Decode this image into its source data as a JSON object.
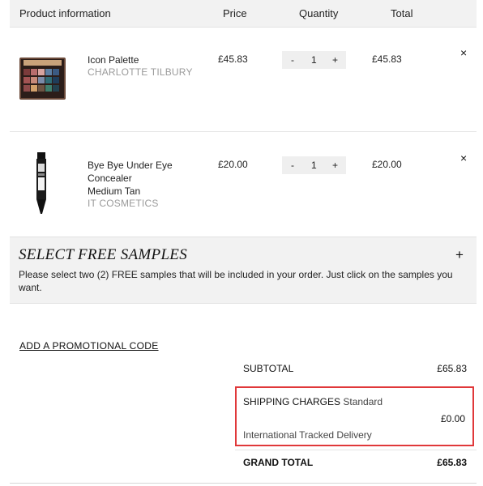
{
  "table_header": {
    "product_info": "Product information",
    "price": "Price",
    "quantity": "Quantity",
    "total": "Total"
  },
  "items": [
    {
      "name": "Icon Palette",
      "variant": "",
      "brand": "CHARLOTTE TILBURY",
      "price": "£45.83",
      "qty_minus": "-",
      "quantity": "1",
      "qty_plus": "+",
      "total": "£45.83",
      "remove": "×",
      "image_icon": "eyeshadow-palette"
    },
    {
      "name_line1": "Bye Bye Under Eye",
      "name_line2": "Concealer",
      "variant": "Medium Tan",
      "brand": "IT COSMETICS",
      "price": "£20.00",
      "qty_minus": "-",
      "quantity": "1",
      "qty_plus": "+",
      "total": "£20.00",
      "remove": "×",
      "image_icon": "concealer-tube"
    }
  ],
  "samples": {
    "title": "SELECT FREE SAMPLES",
    "expand": "+",
    "description": "Please select two (2) FREE samples that will be included in your order. Just click on the samples you want."
  },
  "promo_link": "ADD A PROMOTIONAL CODE",
  "summary": {
    "subtotal_label": "SUBTOTAL",
    "subtotal_value": "£65.83",
    "shipping_label": "SHIPPING CHARGES",
    "shipping_method": "Standard",
    "shipping_value": "£0.00",
    "shipping_description": "International Tracked Delivery",
    "grand_total_label": "GRAND TOTAL",
    "grand_total_value": "£65.83"
  },
  "colors": {
    "header_bg": "#f2f2f2",
    "highlight_border": "#e0383a",
    "brand_text": "#9a9a9a"
  }
}
